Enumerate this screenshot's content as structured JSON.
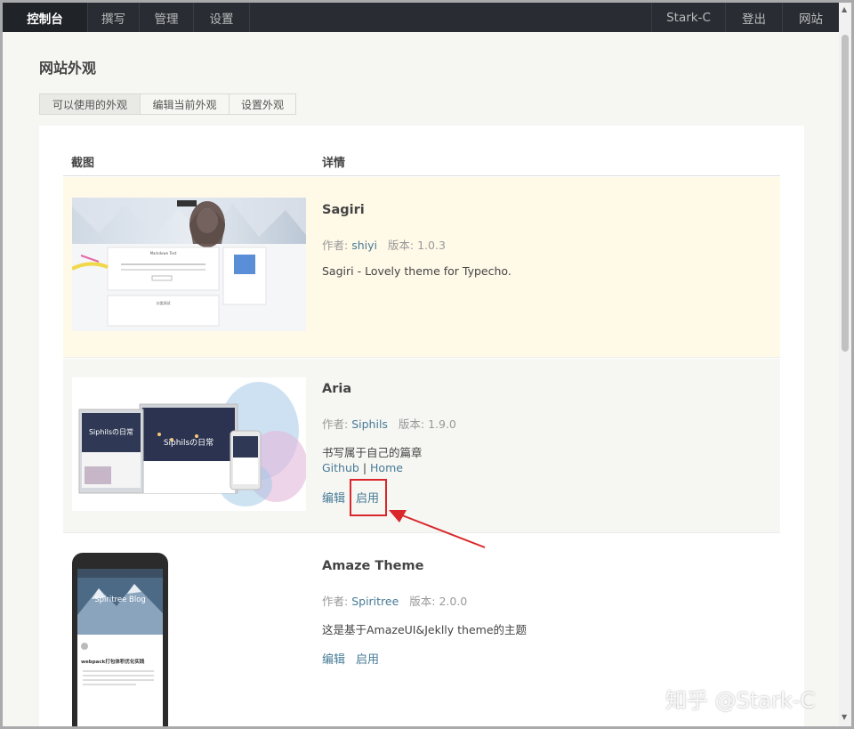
{
  "nav": {
    "left": [
      "控制台",
      "撰写",
      "管理",
      "设置"
    ],
    "right": [
      "Stark-C",
      "登出",
      "网站"
    ]
  },
  "page_title": "网站外观",
  "tabs": [
    "可以使用的外观",
    "编辑当前外观",
    "设置外观"
  ],
  "table": {
    "col_screenshot": "截图",
    "col_details": "详情"
  },
  "themes": [
    {
      "name": "Sagiri",
      "author_label": "作者:",
      "author": "shiyi",
      "version_label": "版本:",
      "version": "1.0.3",
      "description": "Sagiri - Lovely theme for Typecho.",
      "shot_texts": [
        "Markdown Test",
        "分类测试"
      ]
    },
    {
      "name": "Aria",
      "author_label": "作者:",
      "author": "Siphils",
      "version_label": "版本:",
      "version": "1.9.0",
      "description": "书写属于自己的篇章",
      "link_github": "Github",
      "link_sep": "|",
      "link_home": "Home",
      "edit": "编辑",
      "activate": "启用",
      "shot_texts": [
        "Siphilsの日常",
        "Siphilsの日常"
      ]
    },
    {
      "name": "Amaze Theme",
      "author_label": "作者:",
      "author": "Spiritree",
      "version_label": "版本:",
      "version": "2.0.0",
      "description": "这是基于AmazeUI&Jeklly theme的主题",
      "edit": "编辑",
      "activate": "启用",
      "shot_texts": [
        "Spiritree Blog",
        "webpack打包体积优化实践"
      ]
    }
  ],
  "watermark": "知乎 @Stark-C",
  "colors": {
    "nav_bg": "#292d33",
    "link": "#467b96",
    "current_row": "#fff9e8",
    "annotation": "#d9272b"
  }
}
